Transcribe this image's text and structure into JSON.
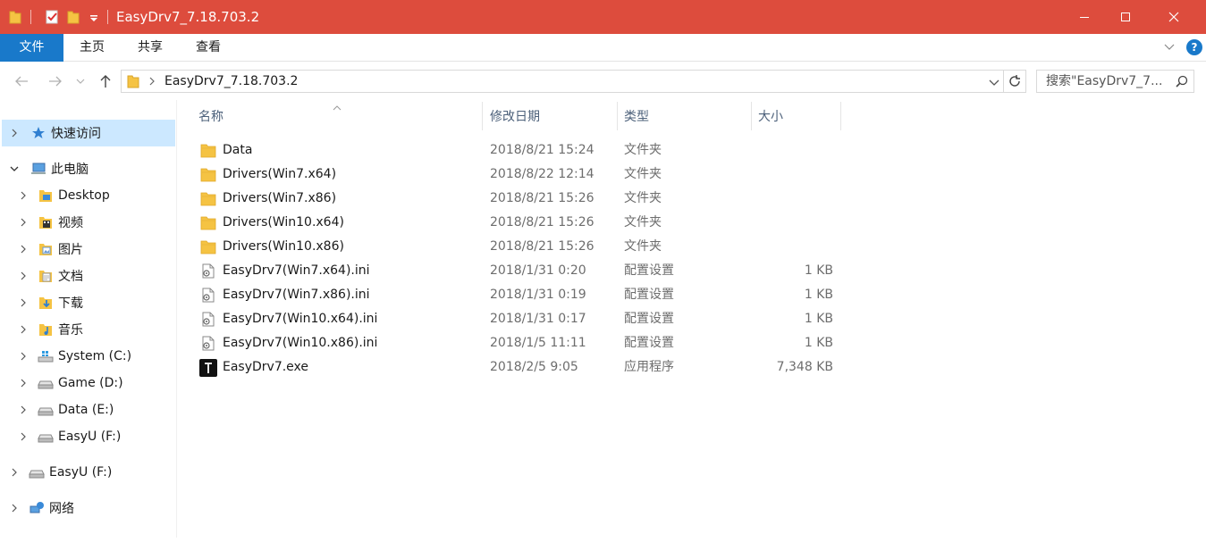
{
  "window": {
    "title": "EasyDrv7_7.18.703.2",
    "colors": {
      "titlebar": "#dd4c3d",
      "accent": "#1979ca",
      "selection": "#cce8ff",
      "folder": "#f5c343"
    }
  },
  "ribbon": {
    "tabs": [
      "文件",
      "主页",
      "共享",
      "查看"
    ],
    "help_label": "?"
  },
  "address": {
    "path": "EasyDrv7_7.18.703.2",
    "search_placeholder": "搜索\"EasyDrv7_7..."
  },
  "nav_tree": [
    {
      "label": "快速访问",
      "icon": "star-icon",
      "selected": true
    },
    {
      "label": "此电脑",
      "icon": "computer-icon",
      "expanded": true
    },
    {
      "label": "Desktop",
      "icon": "desktop-folder-icon"
    },
    {
      "label": "视频",
      "icon": "video-folder-icon"
    },
    {
      "label": "图片",
      "icon": "pictures-folder-icon"
    },
    {
      "label": "文档",
      "icon": "documents-folder-icon"
    },
    {
      "label": "下载",
      "icon": "downloads-folder-icon"
    },
    {
      "label": "音乐",
      "icon": "music-folder-icon"
    },
    {
      "label": "System (C:)",
      "icon": "system-drive-icon"
    },
    {
      "label": "Game (D:)",
      "icon": "drive-icon"
    },
    {
      "label": "Data (E:)",
      "icon": "drive-icon"
    },
    {
      "label": "EasyU (F:)",
      "icon": "drive-icon"
    },
    {
      "label": "EasyU (F:)",
      "icon": "drive-icon"
    },
    {
      "label": "网络",
      "icon": "network-icon"
    }
  ],
  "columns": {
    "name": "名称",
    "date": "修改日期",
    "type": "类型",
    "size": "大小"
  },
  "files": [
    {
      "name": "Data",
      "date": "2018/8/21 15:24",
      "type": "文件夹",
      "size": "",
      "icon": "folder-icon"
    },
    {
      "name": "Drivers(Win7.x64)",
      "date": "2018/8/22 12:14",
      "type": "文件夹",
      "size": "",
      "icon": "folder-icon"
    },
    {
      "name": "Drivers(Win7.x86)",
      "date": "2018/8/21 15:26",
      "type": "文件夹",
      "size": "",
      "icon": "folder-icon"
    },
    {
      "name": "Drivers(Win10.x64)",
      "date": "2018/8/21 15:26",
      "type": "文件夹",
      "size": "",
      "icon": "folder-icon"
    },
    {
      "name": "Drivers(Win10.x86)",
      "date": "2018/8/21 15:26",
      "type": "文件夹",
      "size": "",
      "icon": "folder-icon"
    },
    {
      "name": "EasyDrv7(Win7.x64).ini",
      "date": "2018/1/31 0:20",
      "type": "配置设置",
      "size": "1 KB",
      "icon": "ini-file-icon"
    },
    {
      "name": "EasyDrv7(Win7.x86).ini",
      "date": "2018/1/31 0:19",
      "type": "配置设置",
      "size": "1 KB",
      "icon": "ini-file-icon"
    },
    {
      "name": "EasyDrv7(Win10.x64).ini",
      "date": "2018/1/31 0:17",
      "type": "配置设置",
      "size": "1 KB",
      "icon": "ini-file-icon"
    },
    {
      "name": "EasyDrv7(Win10.x86).ini",
      "date": "2018/1/5 11:11",
      "type": "配置设置",
      "size": "1 KB",
      "icon": "ini-file-icon"
    },
    {
      "name": "EasyDrv7.exe",
      "date": "2018/2/5 9:05",
      "type": "应用程序",
      "size": "7,348 KB",
      "icon": "exe-file-icon"
    }
  ]
}
